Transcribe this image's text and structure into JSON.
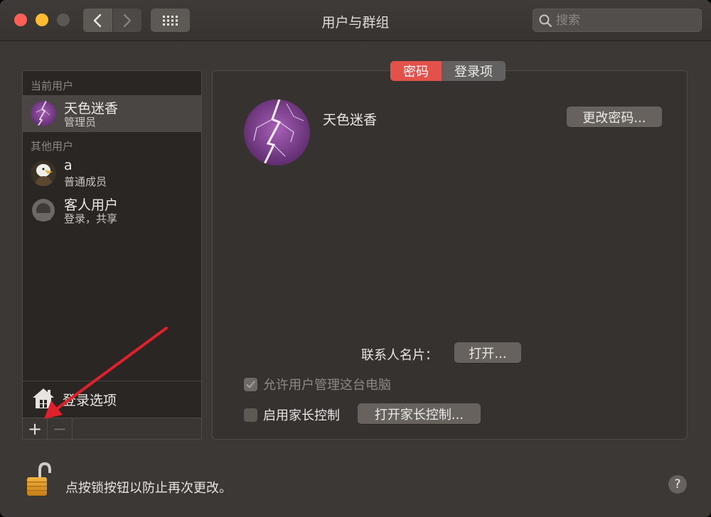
{
  "window": {
    "title": "用户与群组"
  },
  "search": {
    "placeholder": "搜索"
  },
  "sidebar": {
    "current_label": "当前用户",
    "others_label": "其他用户",
    "current_user": {
      "name": "天色迷香",
      "role": "管理员"
    },
    "other_users": [
      {
        "name": "a",
        "role": "普通成员"
      },
      {
        "name": "客人用户",
        "role": "登录，共享"
      }
    ],
    "login_options": "登录选项",
    "add_symbol": "+",
    "remove_symbol": "−"
  },
  "tabs": [
    {
      "label": "密码",
      "active": true
    },
    {
      "label": "登录项",
      "active": false
    }
  ],
  "main": {
    "user_name": "天色迷香",
    "change_password": "更改密码...",
    "contacts_label": "联系人名片：",
    "open_button": "打开...",
    "allow_admin": "允许用户管理这台电脑",
    "parental_label": "启用家长控制",
    "parental_button": "打开家长控制..."
  },
  "footer": {
    "lock_text": "点按锁按钮以防止再次更改。",
    "help_symbol": "?"
  },
  "colors": {
    "accent": "#e3514b",
    "annotation_arrow": "#e0202a"
  }
}
